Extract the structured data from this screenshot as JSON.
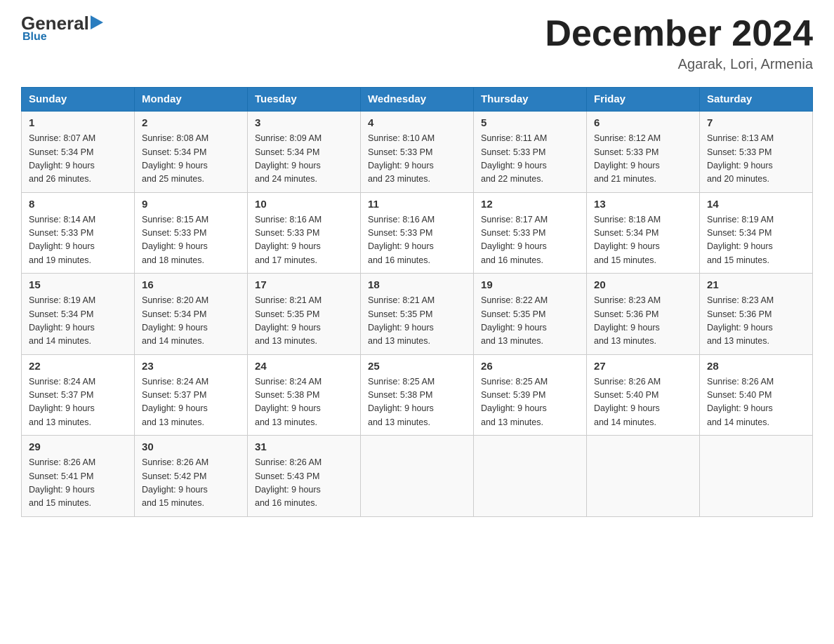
{
  "header": {
    "logo_general": "General",
    "logo_blue": "Blue",
    "month_title": "December 2024",
    "location": "Agarak, Lori, Armenia"
  },
  "weekdays": [
    "Sunday",
    "Monday",
    "Tuesday",
    "Wednesday",
    "Thursday",
    "Friday",
    "Saturday"
  ],
  "weeks": [
    [
      {
        "day": "1",
        "sunrise": "8:07 AM",
        "sunset": "5:34 PM",
        "daylight": "9 hours and 26 minutes."
      },
      {
        "day": "2",
        "sunrise": "8:08 AM",
        "sunset": "5:34 PM",
        "daylight": "9 hours and 25 minutes."
      },
      {
        "day": "3",
        "sunrise": "8:09 AM",
        "sunset": "5:34 PM",
        "daylight": "9 hours and 24 minutes."
      },
      {
        "day": "4",
        "sunrise": "8:10 AM",
        "sunset": "5:33 PM",
        "daylight": "9 hours and 23 minutes."
      },
      {
        "day": "5",
        "sunrise": "8:11 AM",
        "sunset": "5:33 PM",
        "daylight": "9 hours and 22 minutes."
      },
      {
        "day": "6",
        "sunrise": "8:12 AM",
        "sunset": "5:33 PM",
        "daylight": "9 hours and 21 minutes."
      },
      {
        "day": "7",
        "sunrise": "8:13 AM",
        "sunset": "5:33 PM",
        "daylight": "9 hours and 20 minutes."
      }
    ],
    [
      {
        "day": "8",
        "sunrise": "8:14 AM",
        "sunset": "5:33 PM",
        "daylight": "9 hours and 19 minutes."
      },
      {
        "day": "9",
        "sunrise": "8:15 AM",
        "sunset": "5:33 PM",
        "daylight": "9 hours and 18 minutes."
      },
      {
        "day": "10",
        "sunrise": "8:16 AM",
        "sunset": "5:33 PM",
        "daylight": "9 hours and 17 minutes."
      },
      {
        "day": "11",
        "sunrise": "8:16 AM",
        "sunset": "5:33 PM",
        "daylight": "9 hours and 16 minutes."
      },
      {
        "day": "12",
        "sunrise": "8:17 AM",
        "sunset": "5:33 PM",
        "daylight": "9 hours and 16 minutes."
      },
      {
        "day": "13",
        "sunrise": "8:18 AM",
        "sunset": "5:34 PM",
        "daylight": "9 hours and 15 minutes."
      },
      {
        "day": "14",
        "sunrise": "8:19 AM",
        "sunset": "5:34 PM",
        "daylight": "9 hours and 15 minutes."
      }
    ],
    [
      {
        "day": "15",
        "sunrise": "8:19 AM",
        "sunset": "5:34 PM",
        "daylight": "9 hours and 14 minutes."
      },
      {
        "day": "16",
        "sunrise": "8:20 AM",
        "sunset": "5:34 PM",
        "daylight": "9 hours and 14 minutes."
      },
      {
        "day": "17",
        "sunrise": "8:21 AM",
        "sunset": "5:35 PM",
        "daylight": "9 hours and 13 minutes."
      },
      {
        "day": "18",
        "sunrise": "8:21 AM",
        "sunset": "5:35 PM",
        "daylight": "9 hours and 13 minutes."
      },
      {
        "day": "19",
        "sunrise": "8:22 AM",
        "sunset": "5:35 PM",
        "daylight": "9 hours and 13 minutes."
      },
      {
        "day": "20",
        "sunrise": "8:23 AM",
        "sunset": "5:36 PM",
        "daylight": "9 hours and 13 minutes."
      },
      {
        "day": "21",
        "sunrise": "8:23 AM",
        "sunset": "5:36 PM",
        "daylight": "9 hours and 13 minutes."
      }
    ],
    [
      {
        "day": "22",
        "sunrise": "8:24 AM",
        "sunset": "5:37 PM",
        "daylight": "9 hours and 13 minutes."
      },
      {
        "day": "23",
        "sunrise": "8:24 AM",
        "sunset": "5:37 PM",
        "daylight": "9 hours and 13 minutes."
      },
      {
        "day": "24",
        "sunrise": "8:24 AM",
        "sunset": "5:38 PM",
        "daylight": "9 hours and 13 minutes."
      },
      {
        "day": "25",
        "sunrise": "8:25 AM",
        "sunset": "5:38 PM",
        "daylight": "9 hours and 13 minutes."
      },
      {
        "day": "26",
        "sunrise": "8:25 AM",
        "sunset": "5:39 PM",
        "daylight": "9 hours and 13 minutes."
      },
      {
        "day": "27",
        "sunrise": "8:26 AM",
        "sunset": "5:40 PM",
        "daylight": "9 hours and 14 minutes."
      },
      {
        "day": "28",
        "sunrise": "8:26 AM",
        "sunset": "5:40 PM",
        "daylight": "9 hours and 14 minutes."
      }
    ],
    [
      {
        "day": "29",
        "sunrise": "8:26 AM",
        "sunset": "5:41 PM",
        "daylight": "9 hours and 15 minutes."
      },
      {
        "day": "30",
        "sunrise": "8:26 AM",
        "sunset": "5:42 PM",
        "daylight": "9 hours and 15 minutes."
      },
      {
        "day": "31",
        "sunrise": "8:26 AM",
        "sunset": "5:43 PM",
        "daylight": "9 hours and 16 minutes."
      },
      null,
      null,
      null,
      null
    ]
  ]
}
